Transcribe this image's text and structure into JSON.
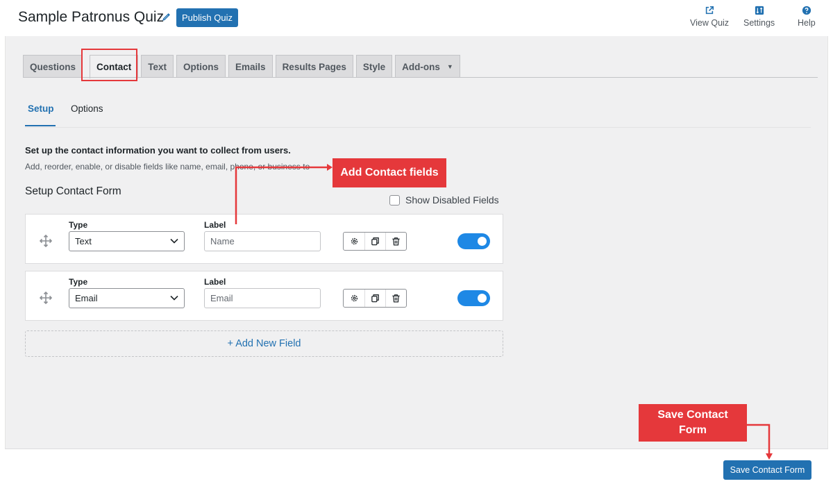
{
  "header": {
    "quiz_title": "Sample Patronus Quiz",
    "publish_label": "Publish Quiz",
    "actions": [
      {
        "label": "View Quiz",
        "icon": "external-link-icon"
      },
      {
        "label": "Settings",
        "icon": "settings-icon"
      },
      {
        "label": "Help",
        "icon": "help-icon"
      }
    ]
  },
  "tabs": [
    {
      "label": "Questions"
    },
    {
      "label": "Contact",
      "active": true
    },
    {
      "label": "Text"
    },
    {
      "label": "Options"
    },
    {
      "label": "Emails"
    },
    {
      "label": "Results Pages"
    },
    {
      "label": "Style"
    },
    {
      "label": "Add-ons",
      "dropdown": true
    }
  ],
  "subtabs": {
    "setup": "Setup",
    "options": "Options"
  },
  "intro": {
    "title": "Set up the contact information you want to collect from users.",
    "description": "Add, reorder, enable, or disable fields like name, email, phone, or business to"
  },
  "form": {
    "section_title": "Setup Contact Form",
    "show_disabled_label": "Show Disabled Fields",
    "type_heading": "Type",
    "label_heading": "Label",
    "fields": [
      {
        "type": "Text",
        "label_placeholder": "Name",
        "enabled": true
      },
      {
        "type": "Email",
        "label_placeholder": "Email",
        "enabled": true
      }
    ],
    "add_field_label": "+ Add New Field"
  },
  "annotations": {
    "add_fields": "Add Contact fields",
    "save_line1": "Save Contact",
    "save_line2": "Form",
    "color": "#e5383b"
  },
  "footer": {
    "save_label": "Save Contact Form"
  },
  "colors": {
    "accent": "#2271b1",
    "toggle_on": "#1e88e5",
    "panel": "#f0f0f1"
  }
}
